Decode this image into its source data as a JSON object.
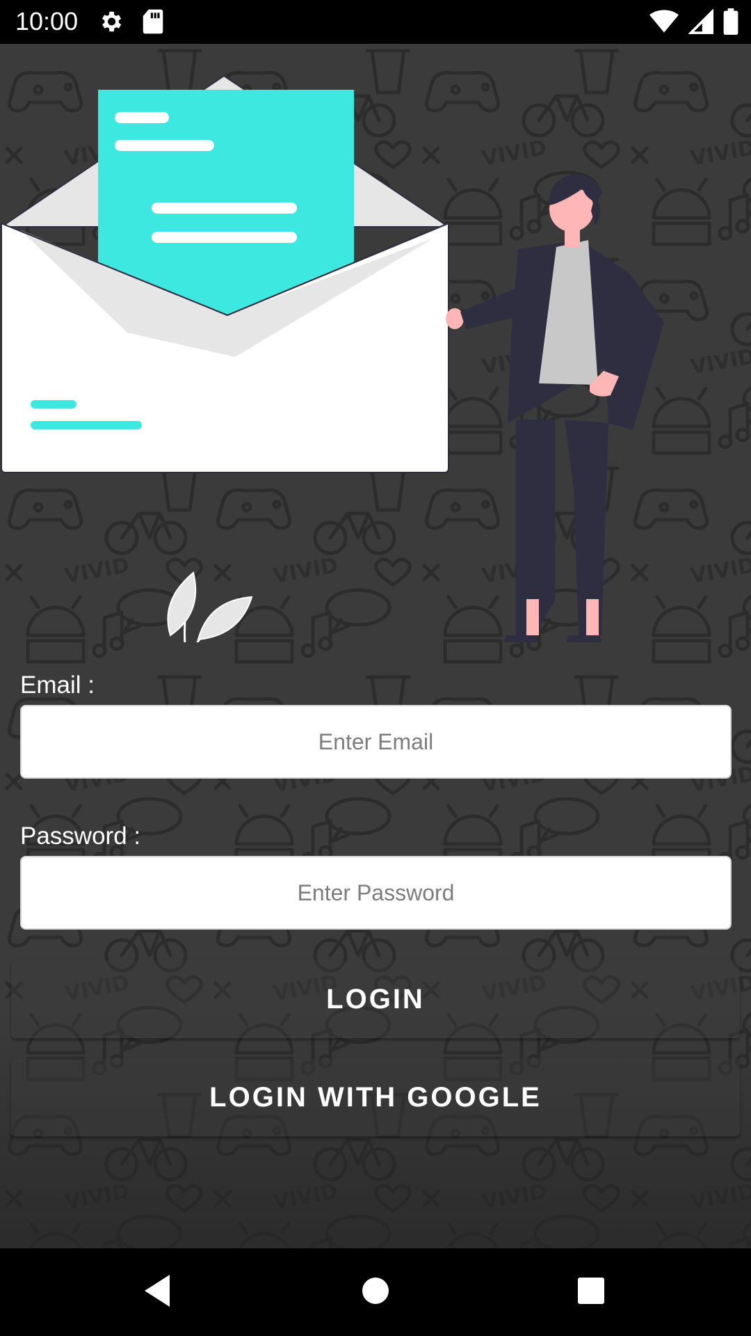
{
  "status_bar": {
    "time": "10:00",
    "left_icons": [
      "gear-icon",
      "sd-card-icon"
    ],
    "right_icons": [
      "wifi-icon",
      "cell-signal-icon",
      "battery-icon"
    ]
  },
  "form": {
    "email": {
      "label": "Email :",
      "placeholder": "Enter Email",
      "value": ""
    },
    "password": {
      "label": "Password :",
      "placeholder": "Enter Password",
      "value": ""
    }
  },
  "buttons": {
    "login": "LOGIN",
    "login_google": "LOGIN WITH GOOGLE"
  },
  "nav_bar": {
    "icons": [
      "back-icon",
      "home-icon",
      "recents-icon"
    ]
  },
  "colors": {
    "background": "#3b3b3b",
    "letter_accent": "#3de8e0",
    "figure_dark": "#2f2e41",
    "figure_skin": "#ffb6b6",
    "figure_shirt": "#c8c8c8",
    "white": "#ffffff"
  }
}
